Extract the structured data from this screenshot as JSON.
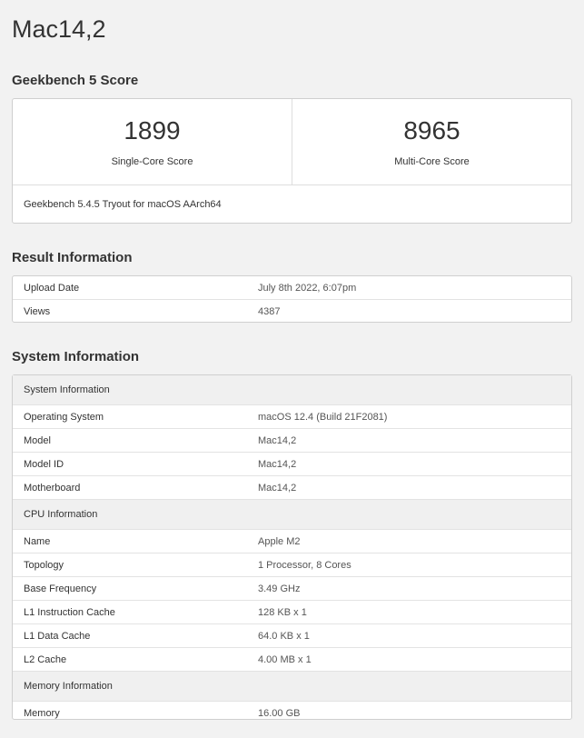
{
  "page": {
    "title": "Mac14,2"
  },
  "score_section": {
    "heading": "Geekbench 5 Score",
    "single_core": {
      "value": "1899",
      "label": "Single-Core Score"
    },
    "multi_core": {
      "value": "8965",
      "label": "Multi-Core Score"
    },
    "footer": "Geekbench 5.4.5 Tryout for macOS AArch64"
  },
  "result_section": {
    "heading": "Result Information",
    "rows": [
      {
        "key": "Upload Date",
        "value": "July 8th 2022, 6:07pm"
      },
      {
        "key": "Views",
        "value": "4387"
      }
    ]
  },
  "system_section": {
    "heading": "System Information",
    "groups": [
      {
        "title": "System Information",
        "rows": [
          {
            "key": "Operating System",
            "value": "macOS 12.4 (Build 21F2081)"
          },
          {
            "key": "Model",
            "value": "Mac14,2"
          },
          {
            "key": "Model ID",
            "value": "Mac14,2"
          },
          {
            "key": "Motherboard",
            "value": "Mac14,2"
          }
        ]
      },
      {
        "title": "CPU Information",
        "rows": [
          {
            "key": "Name",
            "value": "Apple M2"
          },
          {
            "key": "Topology",
            "value": "1 Processor, 8 Cores"
          },
          {
            "key": "Base Frequency",
            "value": "3.49 GHz"
          },
          {
            "key": "L1 Instruction Cache",
            "value": "128 KB x 1"
          },
          {
            "key": "L1 Data Cache",
            "value": "64.0 KB x 1"
          },
          {
            "key": "L2 Cache",
            "value": "4.00 MB x 1"
          }
        ]
      },
      {
        "title": "Memory Information",
        "rows": [
          {
            "key": "Memory",
            "value": "16.00 GB"
          }
        ]
      }
    ]
  }
}
